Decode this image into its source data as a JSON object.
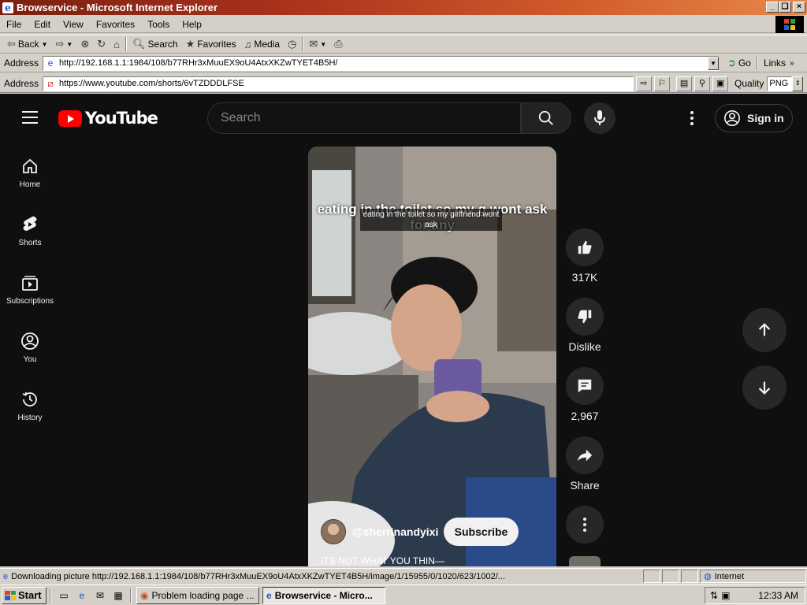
{
  "window": {
    "title": "Browservice - Microsoft Internet Explorer",
    "buttons": [
      "_",
      "❏",
      "×"
    ]
  },
  "menu": [
    "File",
    "Edit",
    "View",
    "Favorites",
    "Tools",
    "Help"
  ],
  "toolbar": {
    "back": "Back",
    "search": "Search",
    "favorites": "Favorites",
    "media": "Media"
  },
  "address1": {
    "label": "Address",
    "url": "http://192.168.1.1:1984/108/b77RHr3xMuuEX9oU4AtxXKZwTYET4B5H/",
    "go": "Go",
    "links": "Links"
  },
  "address2": {
    "label": "Address",
    "url": "https://www.youtube.com/shorts/6vTZDDDLFSE",
    "quality_label": "Quality",
    "quality_value": "PNG"
  },
  "youtube": {
    "logo": "YouTube",
    "search_placeholder": "Search",
    "sign_in": "Sign in",
    "sidebar": [
      {
        "label": "Home",
        "icon": "home-icon"
      },
      {
        "label": "Shorts",
        "icon": "shorts-icon"
      },
      {
        "label": "Subscriptions",
        "icon": "subscriptions-icon"
      },
      {
        "label": "You",
        "icon": "you-icon"
      },
      {
        "label": "History",
        "icon": "history-icon"
      }
    ],
    "video": {
      "caption_big": "eating in the toilet so my g   wont ask for any",
      "caption_small": "eating in the toilet so my girlfriend wont ask",
      "channel": "@sherrinandyixi",
      "subscribe": "Subscribe",
      "description": "ITS NOT WHAT YOU THIN—"
    },
    "actions": {
      "likes": "317K",
      "dislike": "Dislike",
      "comments": "2,967",
      "share": "Share"
    }
  },
  "statusbar": {
    "text": "Downloading picture http://192.168.1.1:1984/108/b77RHr3xMuuEX9oU4AtxXKZwTYET4B5H/image/1/15955/0/1020/623/1002/...",
    "zone": "Internet"
  },
  "taskbar": {
    "start": "Start",
    "tasks": [
      "Problem loading page ...",
      "Browservice - Micro..."
    ],
    "clock": "12:33 AM"
  },
  "colors": {
    "yt_bg": "#0f0f0f",
    "yt_red": "#ff0000",
    "title_gradient_start": "#7b1f10",
    "title_gradient_end": "#e8884a"
  }
}
